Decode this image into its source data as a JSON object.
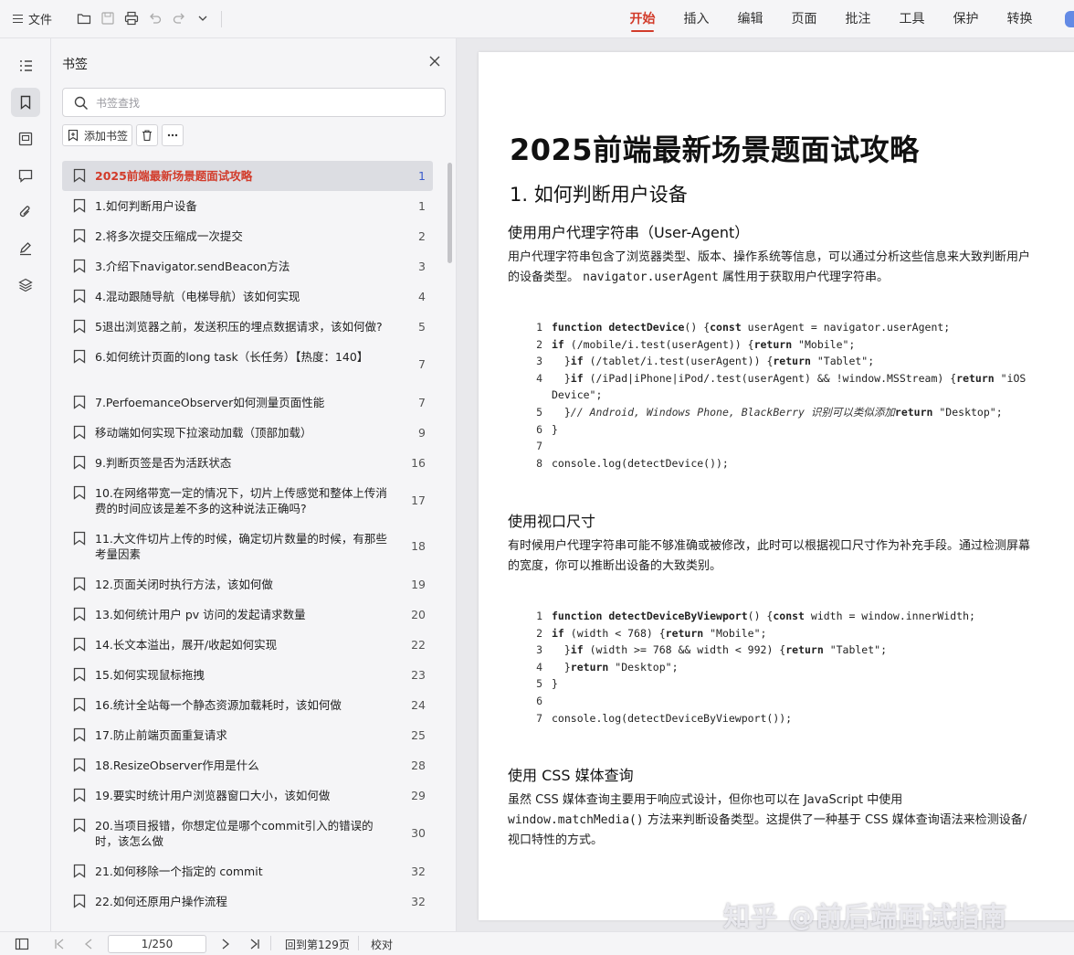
{
  "toolbar": {
    "file_label": "文件",
    "tabs": [
      "开始",
      "插入",
      "编辑",
      "页面",
      "批注",
      "工具",
      "保护",
      "转换"
    ],
    "active_tab": "开始"
  },
  "panel": {
    "title": "书签",
    "search_placeholder": "书签查找",
    "add_bookmark_label": "添加书签"
  },
  "bookmarks": [
    {
      "label": "2025前端最新场景题面试攻略",
      "page": "1"
    },
    {
      "label": "1.如何判断用户设备",
      "page": "1"
    },
    {
      "label": "2.将多次提交压缩成一次提交",
      "page": "2"
    },
    {
      "label": "3.介绍下navigator.sendBeacon方法",
      "page": "3"
    },
    {
      "label": "4.混动跟随导航（电梯导航）该如何实现",
      "page": "4"
    },
    {
      "label": "5退出浏览器之前，发送积压的埋点数据请求，该如何做?",
      "page": "5"
    },
    {
      "label": "6.如何统计页面的long task（长任务）【热度：140】",
      "page": "7"
    },
    {
      "label": "7.PerfoemanceObserver如何测量页面性能",
      "page": "7"
    },
    {
      "label": "移动端如何实现下拉滚动加载（顶部加载）",
      "page": "9"
    },
    {
      "label": "9.判断页签是否为活跃状态",
      "page": "16"
    },
    {
      "label": "10.在网络带宽一定的情况下，切片上传感觉和整体上传消费的时间应该是差不多的这种说法正确吗?",
      "page": "17"
    },
    {
      "label": "11.大文件切片上传的时候，确定切片数量的时候，有那些考量因素",
      "page": "18"
    },
    {
      "label": "12.页面关闭时执行方法，该如何做",
      "page": "19"
    },
    {
      "label": "13.如何统计用户 pv 访问的发起请求数量",
      "page": "20"
    },
    {
      "label": "14.长文本溢出，展开/收起如何实现",
      "page": "22"
    },
    {
      "label": "15.如何实现鼠标拖拽",
      "page": "23"
    },
    {
      "label": "16.统计全站每一个静态资源加载耗时，该如何做",
      "page": "24"
    },
    {
      "label": "17.防止前端页面重复请求",
      "page": "25"
    },
    {
      "label": "18.ResizeObserver作用是什么",
      "page": "28"
    },
    {
      "label": "19.要实时统计用户浏览器窗口大小，该如何做",
      "page": "29"
    },
    {
      "label": "20.当项目报错，你想定位是哪个commit引入的错误的时，该怎么做",
      "page": "30"
    },
    {
      "label": "21.如何移除一个指定的 commit",
      "page": "32"
    },
    {
      "label": "22.如何还原用户操作流程",
      "page": "32"
    }
  ],
  "doc": {
    "title": "2025前端最新场景题面试攻略",
    "section": "1. 如何判断用户设备",
    "ua_heading": "使用用户代理字符串（User-Agent）",
    "ua_para_a": "用户代理字符串包含了浏览器类型、版本、操作系统等信息，可以通过分析这些信息来大致判断用户",
    "ua_para_b": "的设备类型。",
    "ua_para_code": "navigator.userAgent",
    "ua_para_c": "属性用于获取用户代理字符串。",
    "code1_numbers": [
      "1",
      "2",
      "3",
      "4",
      "",
      "5",
      "6",
      "7",
      "8"
    ],
    "viewport_heading": "使用视口尺寸",
    "viewport_para_a": "有时候用户代理字符串可能不够准确或被修改，此时可以根据视口尺寸作为补充手段。通过检测屏幕",
    "viewport_para_b": "的宽度，你可以推断出设备的大致类别。",
    "code2_numbers": [
      "1",
      "2",
      "3",
      "4",
      "5",
      "6",
      "7"
    ],
    "css_heading": "使用 CSS 媒体查询",
    "css_para_a": "虽然 CSS 媒体查询主要用于响应式设计，但你也可以在 JavaScript 中使用",
    "css_para_code": "window.matchMedia()",
    "css_para_b": "方法来判断设备类型。这提供了一种基于 CSS 媒体查询语法来检测设备/",
    "css_para_c": "视口特性的方式。"
  },
  "code": {
    "l1_kw1": "function",
    "l1_fn": "detectDevice",
    "l1_a": "() {",
    "l1_kw2": "const",
    "l1_b": " userAgent = navigator.userAgent;",
    "l2_kw": "if",
    "l2_a": " (/mobile/i.test(userAgent)) {",
    "l2_kw2": "return",
    "l2_s": " \"Mobile\";",
    "l3_a": "  }",
    "l3_kw": "if",
    "l3_b": " (/tablet/i.test(userAgent)) {",
    "l3_kw2": "return",
    "l3_s": " \"Tablet\";",
    "l4_a": "  }",
    "l4_kw": "if",
    "l4_b": " (/iPad|iPhone|iPod/.test(userAgent) && !window.MSStream) {",
    "l4_kw2": "return",
    "l4_s": " \"iOS",
    "l4_cont": "Device\";",
    "l5_a": "  }",
    "l5_cm": "// Android, Windows Phone, BlackBerry 识别可以类似添加",
    "l5_kw": "return",
    "l5_s": " \"Desktop\";",
    "l6": "}",
    "l8": "console.log(detectDevice());",
    "v1_kw1": "function",
    "v1_fn": "detectDeviceByViewport",
    "v1_a": "() {",
    "v1_kw2": "const",
    "v1_b": " width = window.innerWidth;",
    "v2_kw": "if",
    "v2_a": " (width < 768) {",
    "v2_kw2": "return",
    "v2_s": " \"Mobile\";",
    "v3_a": "  }",
    "v3_kw": "if",
    "v3_b": " (width >= 768 && width < 992) {",
    "v3_kw2": "return",
    "v3_s": " \"Tablet\";",
    "v4_a": "  }",
    "v4_kw": "return",
    "v4_s": " \"Desktop\";",
    "v5": "}",
    "v7": "console.log(detectDeviceByViewport());"
  },
  "watermark": "知乎 @前后端面试指南",
  "status": {
    "page_value": "1/250",
    "back_label": "回到第129页",
    "proof_label": "校对"
  }
}
